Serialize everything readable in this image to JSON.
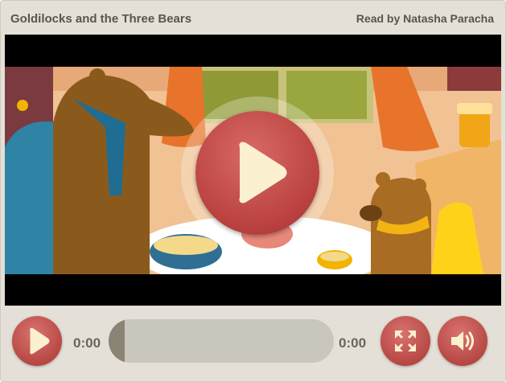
{
  "header": {
    "title": "Goldilocks and the Three Bears",
    "reader": "Read by Natasha Paracha"
  },
  "video": {
    "big_play_icon": "play-icon"
  },
  "controls": {
    "play_icon": "play-icon",
    "current_time": "0:00",
    "duration": "0:00",
    "progress": 0,
    "fullscreen_icon": "fullscreen-icon",
    "volume_icon": "volume-icon"
  },
  "colors": {
    "accent": "#b9403f",
    "frame": "#e4e0d8",
    "track": "#c9c6be",
    "text": "#5a5547"
  }
}
